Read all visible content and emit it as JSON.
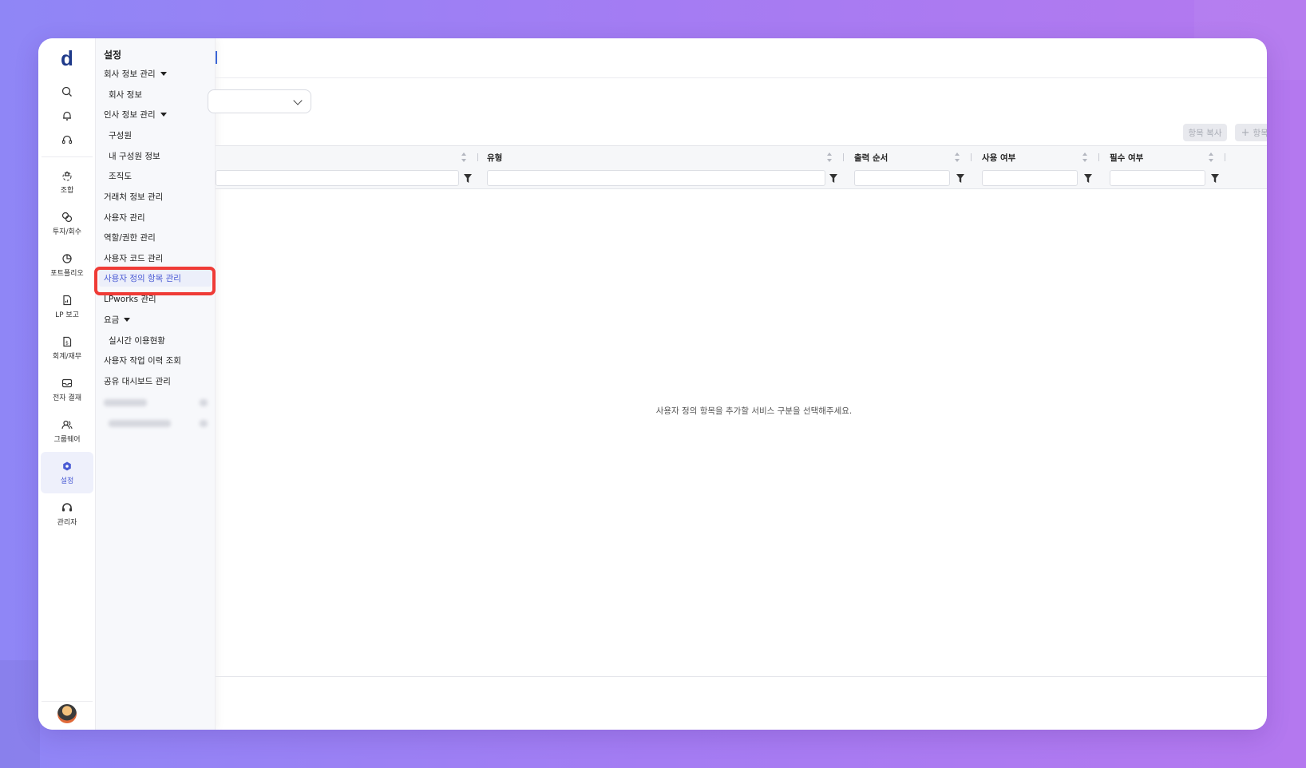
{
  "app": {
    "logo": "d"
  },
  "rail": {
    "items": [
      {
        "label": "조합",
        "icon": "recycle-icon"
      },
      {
        "label": "투자/회수",
        "icon": "coins-icon"
      },
      {
        "label": "포트폴리오",
        "icon": "pie-chart-icon"
      },
      {
        "label": "LP 보고",
        "icon": "report-document-icon"
      },
      {
        "label": "회계/재무",
        "icon": "finance-document-icon"
      },
      {
        "label": "전자 결재",
        "icon": "inbox-icon"
      },
      {
        "label": "그룹웨어",
        "icon": "people-icon"
      },
      {
        "label": "설정",
        "icon": "gear-icon",
        "active": true
      },
      {
        "label": "관리자",
        "icon": "admin-headset-icon"
      }
    ]
  },
  "submenu": {
    "title": "설정",
    "items": [
      {
        "label": "회사 정보 관리",
        "expandable": true
      },
      {
        "label": "회사 정보",
        "sub": true
      },
      {
        "label": "인사 정보 관리",
        "expandable": true
      },
      {
        "label": "구성원",
        "sub": true
      },
      {
        "label": "내 구성원 정보",
        "sub": true
      },
      {
        "label": "조직도",
        "sub": true
      },
      {
        "label": "거래처 정보 관리"
      },
      {
        "label": "사용자 관리"
      },
      {
        "label": "역할/권한 관리"
      },
      {
        "label": "사용자 코드 관리"
      },
      {
        "label": "사용자 정의 항목 관리",
        "selected": true
      },
      {
        "label": "LPworks 관리"
      },
      {
        "label": "요금",
        "expandable": true
      },
      {
        "label": "실시간 이용현황",
        "sub": true
      },
      {
        "label": "사용자 작업 이력 조회"
      },
      {
        "label": "공유 대시보드 관리"
      }
    ]
  },
  "toolbar": {
    "copy_label": "항목 복사",
    "add_label": "항목 추가"
  },
  "grid": {
    "columns": [
      "",
      "유형",
      "출력 순서",
      "사용 여부",
      "필수 여부"
    ],
    "empty_message": "사용자 정의 항목을 추가할 서비스 구분을 선택해주세요."
  },
  "colors": {
    "accent": "#4a5bd4",
    "highlight": "#ef3b36",
    "logo": "#1f3a8a"
  }
}
